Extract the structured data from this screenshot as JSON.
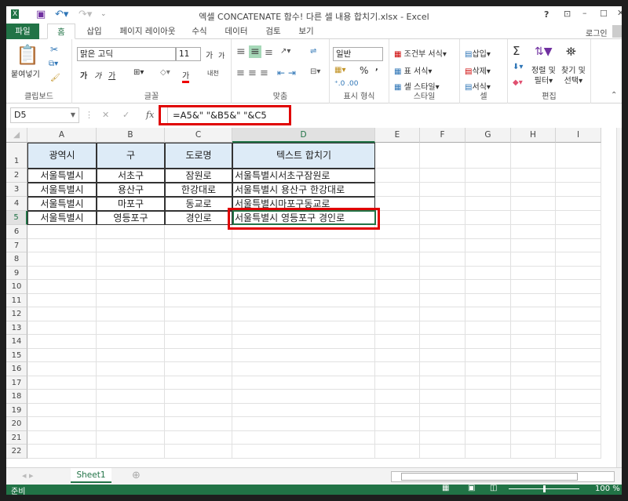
{
  "window": {
    "title": "엑셀 CONCATENATE 함수! 다른 셀 내용 합치기.xlsx - Excel",
    "help": "?",
    "login": "로그인"
  },
  "tabs": [
    "파일",
    "홈",
    "삽입",
    "페이지 레이아웃",
    "수식",
    "데이터",
    "검토",
    "보기"
  ],
  "ribbon": {
    "clipboard": {
      "paste": "붙여넣기",
      "label": "클립보드"
    },
    "font": {
      "name": "맑은 고딕",
      "size": "11",
      "grow": "가",
      "shrink": "가",
      "bold": "가",
      "italic": "가",
      "underline": "가",
      "color": "가",
      "phonetic": "내천",
      "label": "글꼴"
    },
    "align": {
      "label": "맞춤"
    },
    "number": {
      "format": "일반",
      "percent": "%",
      "comma": ",",
      "label": "표시 형식"
    },
    "styles": {
      "conditional": "조건부 서식",
      "table": "표 서식",
      "cell": "셀 스타일",
      "label": "스타일"
    },
    "cells": {
      "insert": "삽입",
      "delete": "삭제",
      "format": "서식",
      "label": "셀"
    },
    "editing": {
      "sum": "Σ",
      "sort": "정렬 및 필터",
      "find": "찾기 및 선택",
      "sort1": "정렬 및",
      "sort2": "필터",
      "find1": "찾기 및",
      "find2": "선택",
      "label": "편집"
    }
  },
  "formula_bar": {
    "name_box": "D5",
    "fx": "fx",
    "formula": "=A5&\" \"&B5&\" \"&C5"
  },
  "columns": [
    "A",
    "B",
    "C",
    "D",
    "E",
    "F",
    "G",
    "H",
    "I"
  ],
  "rows": [
    "1",
    "2",
    "3",
    "4",
    "5",
    "6",
    "7",
    "8",
    "9",
    "10",
    "11",
    "12",
    "13",
    "14",
    "15",
    "16",
    "17",
    "18",
    "19",
    "20",
    "21",
    "22"
  ],
  "table": {
    "headers": [
      "광역시",
      "구",
      "도로명",
      "텍스트 합치기"
    ],
    "data": [
      [
        "서울특별시",
        "서초구",
        "잠원로",
        "서울특별시서초구잠원로"
      ],
      [
        "서울특별시",
        "용산구",
        "한강대로",
        "서울특별시  용산구 한강대로"
      ],
      [
        "서울특별시",
        "마포구",
        "동교로",
        "서울특별시마포구동교로"
      ],
      [
        "서울특별시",
        "영등포구",
        "경인로",
        "서울특별시 영등포구 경인로"
      ]
    ]
  },
  "sheet_tabs": [
    "Sheet1"
  ],
  "status": {
    "ready": "준비",
    "zoom": "100 %"
  }
}
